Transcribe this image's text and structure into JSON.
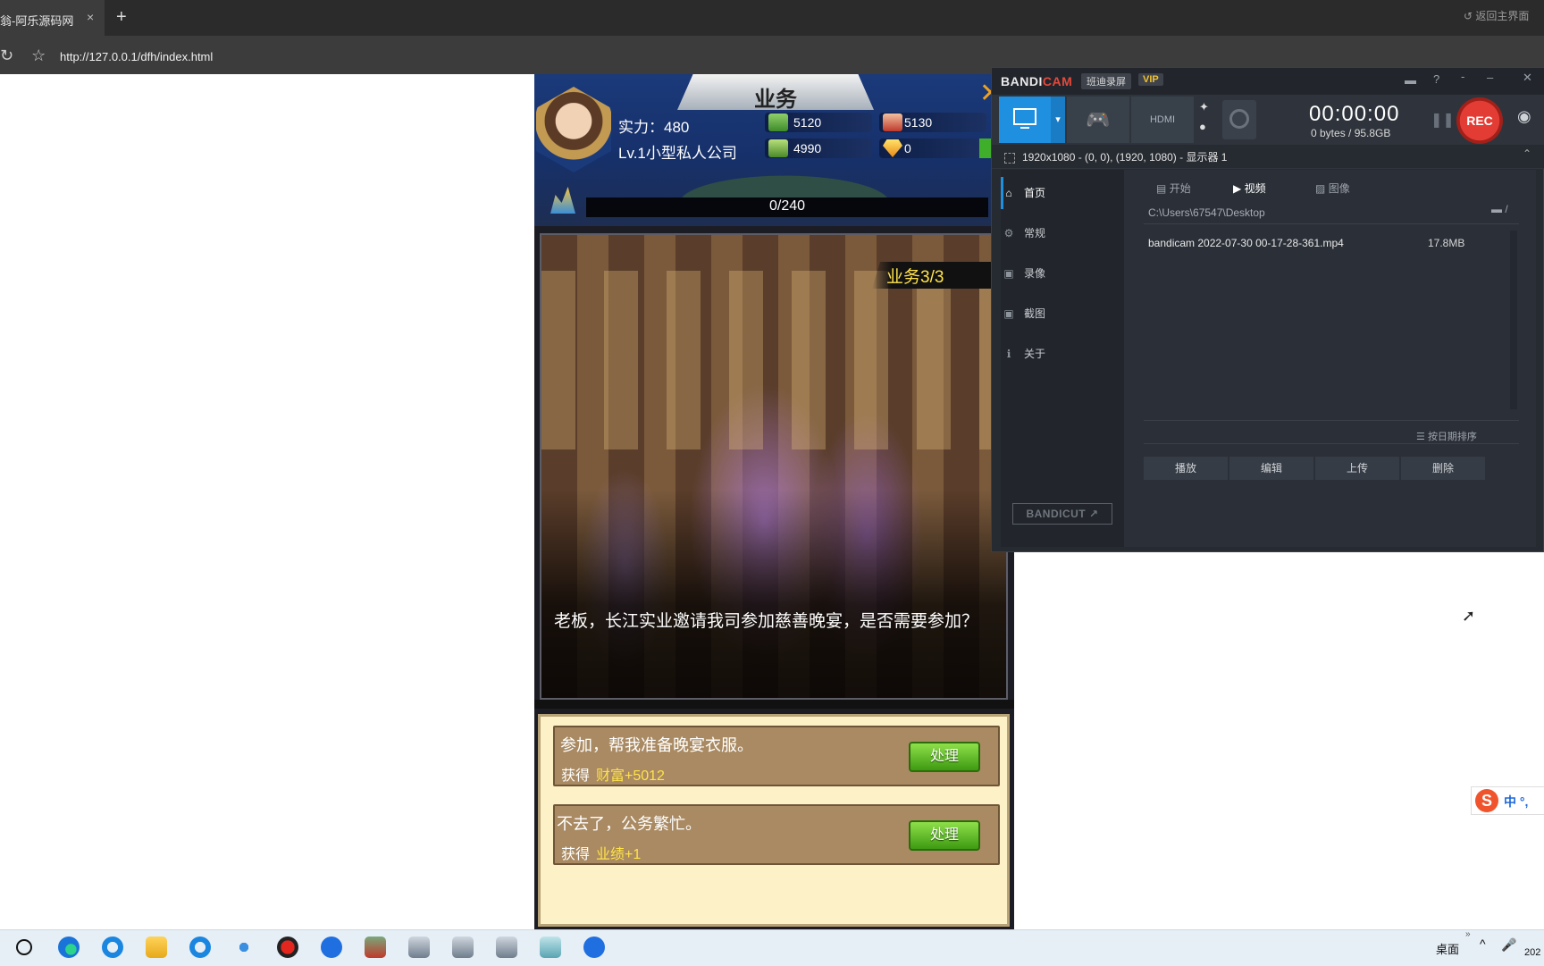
{
  "browser": {
    "tab_title": "翁-阿乐源码网",
    "tab_close": "×",
    "new_tab": "+",
    "back_to_main": "返回主界面",
    "url": "http://127.0.0.1/dfh/index.html",
    "icons": [
      "refresh-icon",
      "star-icon"
    ]
  },
  "game": {
    "title": "业务",
    "power": "实力：480",
    "level": "Lv.1小型私人公司",
    "resources": [
      {
        "icon": "money-icon",
        "value": "5120"
      },
      {
        "icon": "people-icon",
        "value": "5130"
      },
      {
        "icon": "goods-icon",
        "value": "4990"
      },
      {
        "icon": "diamond-icon",
        "value": "0"
      }
    ],
    "performance_icon_label": "业绩",
    "performance": "0/240",
    "badge": "业务3/3",
    "story": "老板，长江实业邀请我司参加慈善晚宴，是否需要参加？",
    "choices": [
      {
        "text": "参加，帮我准备晚宴衣服。",
        "gain_label": "获得",
        "gain_value": "财富+5012",
        "button": "处理"
      },
      {
        "text": "不去了，公务繁忙。",
        "gain_label": "获得",
        "gain_value": "业绩+1",
        "button": "处理"
      }
    ]
  },
  "bandicam": {
    "logo_a": "BANDI",
    "logo_b": "CAM",
    "cn_name": "班迪录屏",
    "vip": "VIP",
    "timer": "00:00:00",
    "size": "0 bytes / 95.8GB",
    "rec": "REC",
    "region": "1920x1080 - (0, 0), (1920, 1080) - 显示器 1",
    "sidebar": [
      "首页",
      "常规",
      "录像",
      "截图",
      "关于"
    ],
    "bandicut": "BANDICUT ↗",
    "tabs": [
      "开始",
      "视频",
      "图像"
    ],
    "path": "C:\\Users\\67547\\Desktop",
    "file_name": "bandicam 2022-07-30 00-17-28-361.mp4",
    "file_size": "17.8MB",
    "sort": "按日期排序",
    "actions": [
      "播放",
      "编辑",
      "上传",
      "删除"
    ]
  },
  "ime": {
    "logo": "S",
    "text": "中 °,"
  },
  "taskbar": {
    "desktop_label": "桌面",
    "clock": "202"
  },
  "colors": {
    "bandicam_accent": "#1f8fe0",
    "rec_red": "#e23c34",
    "gain_yellow": "#ffe34a",
    "button_green": "#5fbe24"
  }
}
